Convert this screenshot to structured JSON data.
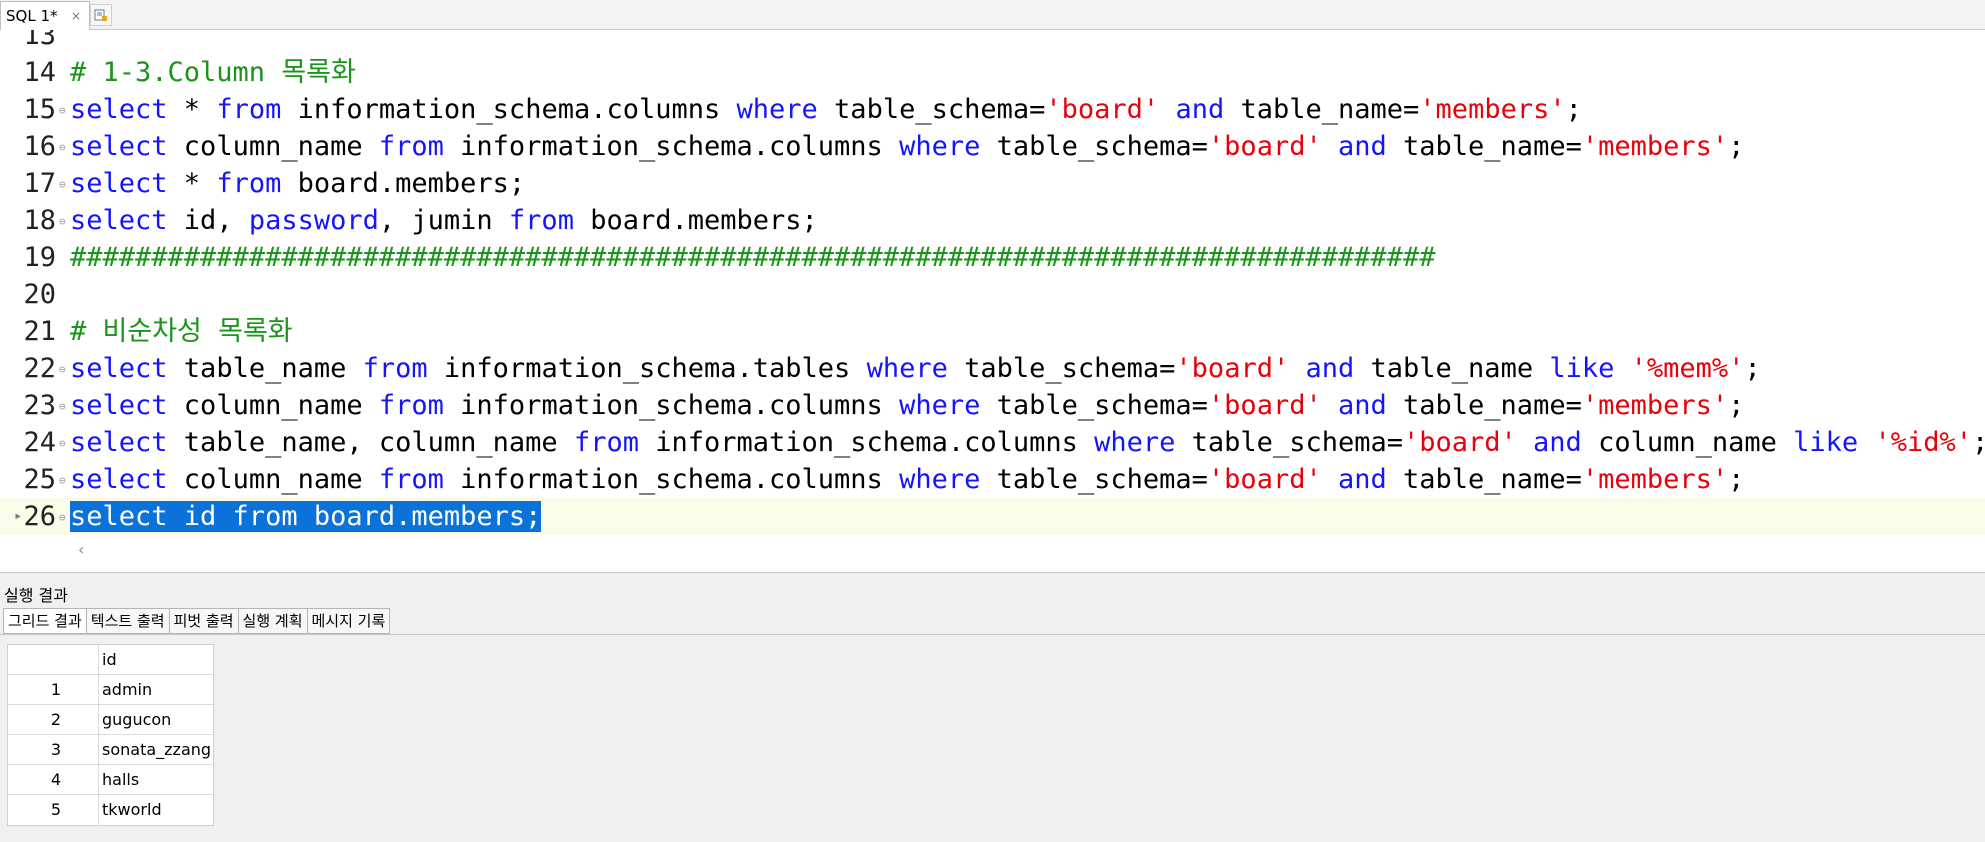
{
  "tab": {
    "title": "SQL 1*",
    "close_icon": "×"
  },
  "editor": {
    "lines": [
      {
        "number": "13",
        "segments": []
      },
      {
        "number": "14",
        "segments": [
          {
            "text": "# 1-3.Column 목록화",
            "type": "comment"
          }
        ]
      },
      {
        "number": "15",
        "segments": [
          {
            "text": "select",
            "type": "keyword"
          },
          {
            "text": " * ",
            "type": "plain"
          },
          {
            "text": "from",
            "type": "keyword"
          },
          {
            "text": " information_schema.columns ",
            "type": "plain"
          },
          {
            "text": "where",
            "type": "keyword"
          },
          {
            "text": " table_schema=",
            "type": "plain"
          },
          {
            "text": "'board'",
            "type": "string"
          },
          {
            "text": " ",
            "type": "plain"
          },
          {
            "text": "and",
            "type": "keyword"
          },
          {
            "text": " table_name=",
            "type": "plain"
          },
          {
            "text": "'members'",
            "type": "string"
          },
          {
            "text": ";",
            "type": "plain"
          }
        ]
      },
      {
        "number": "16",
        "segments": [
          {
            "text": "select",
            "type": "keyword"
          },
          {
            "text": " column_name ",
            "type": "plain"
          },
          {
            "text": "from",
            "type": "keyword"
          },
          {
            "text": " information_schema.columns ",
            "type": "plain"
          },
          {
            "text": "where",
            "type": "keyword"
          },
          {
            "text": " table_schema=",
            "type": "plain"
          },
          {
            "text": "'board'",
            "type": "string"
          },
          {
            "text": " ",
            "type": "plain"
          },
          {
            "text": "and",
            "type": "keyword"
          },
          {
            "text": " table_name=",
            "type": "plain"
          },
          {
            "text": "'members'",
            "type": "string"
          },
          {
            "text": ";",
            "type": "plain"
          }
        ]
      },
      {
        "number": "17",
        "segments": [
          {
            "text": "select",
            "type": "keyword"
          },
          {
            "text": " * ",
            "type": "plain"
          },
          {
            "text": "from",
            "type": "keyword"
          },
          {
            "text": " board.members;",
            "type": "plain"
          }
        ]
      },
      {
        "number": "18",
        "segments": [
          {
            "text": "select",
            "type": "keyword"
          },
          {
            "text": " id, ",
            "type": "plain"
          },
          {
            "text": "password",
            "type": "keyword"
          },
          {
            "text": ", jumin ",
            "type": "plain"
          },
          {
            "text": "from",
            "type": "keyword"
          },
          {
            "text": " board.members;",
            "type": "plain"
          }
        ]
      },
      {
        "number": "19",
        "segments": [
          {
            "text": "####################################################################################",
            "type": "comment"
          }
        ]
      },
      {
        "number": "20",
        "segments": []
      },
      {
        "number": "21",
        "segments": [
          {
            "text": "# 비순차성 목록화",
            "type": "comment"
          }
        ]
      },
      {
        "number": "22",
        "segments": [
          {
            "text": "select",
            "type": "keyword"
          },
          {
            "text": " table_name ",
            "type": "plain"
          },
          {
            "text": "from",
            "type": "keyword"
          },
          {
            "text": " information_schema.tables ",
            "type": "plain"
          },
          {
            "text": "where",
            "type": "keyword"
          },
          {
            "text": " table_schema=",
            "type": "plain"
          },
          {
            "text": "'board'",
            "type": "string"
          },
          {
            "text": " ",
            "type": "plain"
          },
          {
            "text": "and",
            "type": "keyword"
          },
          {
            "text": " table_name ",
            "type": "plain"
          },
          {
            "text": "like",
            "type": "keyword"
          },
          {
            "text": " ",
            "type": "plain"
          },
          {
            "text": "'%mem%'",
            "type": "string"
          },
          {
            "text": ";",
            "type": "plain"
          }
        ]
      },
      {
        "number": "23",
        "segments": [
          {
            "text": "select",
            "type": "keyword"
          },
          {
            "text": " column_name ",
            "type": "plain"
          },
          {
            "text": "from",
            "type": "keyword"
          },
          {
            "text": " information_schema.columns ",
            "type": "plain"
          },
          {
            "text": "where",
            "type": "keyword"
          },
          {
            "text": " table_schema=",
            "type": "plain"
          },
          {
            "text": "'board'",
            "type": "string"
          },
          {
            "text": " ",
            "type": "plain"
          },
          {
            "text": "and",
            "type": "keyword"
          },
          {
            "text": " table_name=",
            "type": "plain"
          },
          {
            "text": "'members'",
            "type": "string"
          },
          {
            "text": ";",
            "type": "plain"
          }
        ]
      },
      {
        "number": "24",
        "segments": [
          {
            "text": "select",
            "type": "keyword"
          },
          {
            "text": " table_name, column_name ",
            "type": "plain"
          },
          {
            "text": "from",
            "type": "keyword"
          },
          {
            "text": " information_schema.columns ",
            "type": "plain"
          },
          {
            "text": "where",
            "type": "keyword"
          },
          {
            "text": " table_schema=",
            "type": "plain"
          },
          {
            "text": "'board'",
            "type": "string"
          },
          {
            "text": " ",
            "type": "plain"
          },
          {
            "text": "and",
            "type": "keyword"
          },
          {
            "text": " column_name ",
            "type": "plain"
          },
          {
            "text": "like",
            "type": "keyword"
          },
          {
            "text": " ",
            "type": "plain"
          },
          {
            "text": "'%id%'",
            "type": "string"
          },
          {
            "text": ";",
            "type": "plain"
          }
        ]
      },
      {
        "number": "25",
        "segments": [
          {
            "text": "select",
            "type": "keyword"
          },
          {
            "text": " column_name ",
            "type": "plain"
          },
          {
            "text": "from",
            "type": "keyword"
          },
          {
            "text": " information_schema.columns ",
            "type": "plain"
          },
          {
            "text": "where",
            "type": "keyword"
          },
          {
            "text": " table_schema=",
            "type": "plain"
          },
          {
            "text": "'board'",
            "type": "string"
          },
          {
            "text": " ",
            "type": "plain"
          },
          {
            "text": "and",
            "type": "keyword"
          },
          {
            "text": " table_name=",
            "type": "plain"
          },
          {
            "text": "'members'",
            "type": "string"
          },
          {
            "text": ";",
            "type": "plain"
          }
        ]
      },
      {
        "number": "26",
        "current": true,
        "segments": [
          {
            "text": "select id from board.members;",
            "type": "selected"
          }
        ]
      }
    ]
  },
  "results": {
    "title": "실행 결과",
    "tabs": [
      {
        "label": "그리드 결과",
        "active": true
      },
      {
        "label": "텍스트 출력"
      },
      {
        "label": "피벗 출력"
      },
      {
        "label": "실행 계획"
      },
      {
        "label": "메시지 기록"
      }
    ],
    "grid": {
      "column": "id",
      "rows": [
        {
          "num": "1",
          "id": "admin"
        },
        {
          "num": "2",
          "id": "gugucon"
        },
        {
          "num": "3",
          "id": "sonata_zzang"
        },
        {
          "num": "4",
          "id": "halls"
        },
        {
          "num": "5",
          "id": "tkworld"
        }
      ]
    }
  },
  "colors": {
    "keyword": "#1414ff",
    "string": "#e8000b",
    "comment": "#1a951a",
    "selection": "#0a72d8"
  }
}
